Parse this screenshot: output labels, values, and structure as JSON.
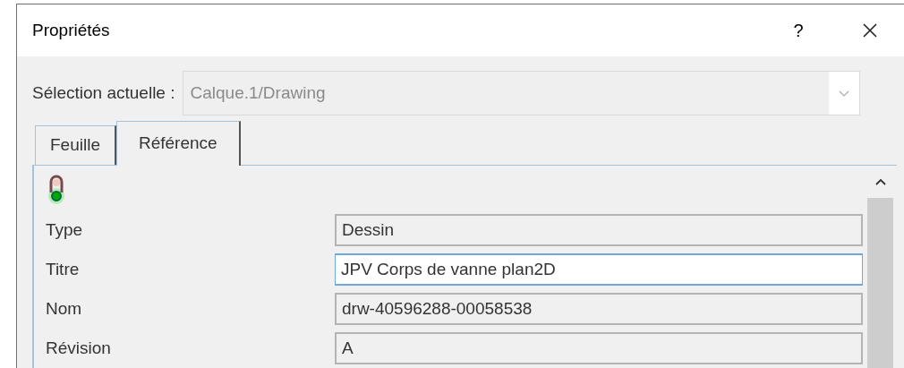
{
  "window": {
    "title": "Propriétés",
    "help": "?"
  },
  "selection": {
    "label": "Sélection actuelle :",
    "value": "Calque.1/Drawing"
  },
  "tabs": [
    {
      "label": "Feuille",
      "selected": false
    },
    {
      "label": "Référence",
      "selected": true
    }
  ],
  "fields": [
    {
      "label": "Type",
      "value": "Dessin",
      "focused": false
    },
    {
      "label": "Titre",
      "value": "JPV Corps de vanne plan2D",
      "focused": true
    },
    {
      "label": "Nom",
      "value": "drw-40596288-00058538",
      "focused": false
    },
    {
      "label": "Révision",
      "value": "A",
      "focused": false
    }
  ]
}
